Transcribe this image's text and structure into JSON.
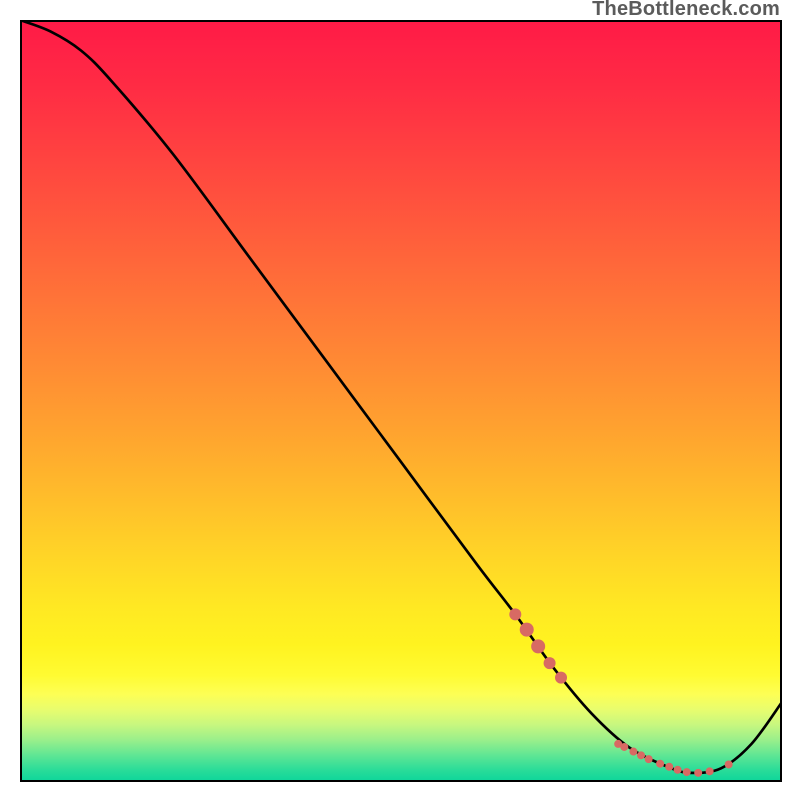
{
  "watermark": "TheBottleneck.com",
  "chart_data": {
    "type": "line",
    "title": "",
    "xlabel": "",
    "ylabel": "",
    "xlim": [
      0,
      100
    ],
    "ylim": [
      0,
      100
    ],
    "series": [
      {
        "name": "curve",
        "x": [
          0,
          4,
          8,
          12,
          20,
          30,
          40,
          50,
          60,
          65,
          70,
          75,
          80,
          85,
          88,
          92,
          96,
          100
        ],
        "y": [
          100,
          98.5,
          96,
          92,
          82.5,
          69,
          55.5,
          42,
          28.5,
          22,
          15,
          9,
          4.5,
          2,
          1.2,
          1.8,
          5,
          10.5
        ]
      }
    ],
    "markers": {
      "name": "highlighted-points",
      "color": "#d86a63",
      "points": [
        {
          "x": 65.0,
          "y": 22.0,
          "r": 6
        },
        {
          "x": 66.5,
          "y": 20.0,
          "r": 7
        },
        {
          "x": 68.0,
          "y": 17.8,
          "r": 7
        },
        {
          "x": 69.5,
          "y": 15.6,
          "r": 6
        },
        {
          "x": 71.0,
          "y": 13.7,
          "r": 6
        },
        {
          "x": 78.5,
          "y": 5.0,
          "r": 4
        },
        {
          "x": 79.3,
          "y": 4.6,
          "r": 4
        },
        {
          "x": 80.5,
          "y": 4.0,
          "r": 4
        },
        {
          "x": 81.5,
          "y": 3.5,
          "r": 4
        },
        {
          "x": 82.5,
          "y": 3.0,
          "r": 4
        },
        {
          "x": 84.0,
          "y": 2.4,
          "r": 4
        },
        {
          "x": 85.2,
          "y": 2.0,
          "r": 4
        },
        {
          "x": 86.3,
          "y": 1.6,
          "r": 4
        },
        {
          "x": 87.5,
          "y": 1.3,
          "r": 4
        },
        {
          "x": 89.0,
          "y": 1.2,
          "r": 4
        },
        {
          "x": 90.5,
          "y": 1.4,
          "r": 4
        },
        {
          "x": 93.0,
          "y": 2.3,
          "r": 4
        }
      ]
    },
    "gradient_stops": [
      {
        "offset": 0.0,
        "color": "#ff1a47"
      },
      {
        "offset": 0.09,
        "color": "#ff2c44"
      },
      {
        "offset": 0.18,
        "color": "#ff4340"
      },
      {
        "offset": 0.27,
        "color": "#ff5a3c"
      },
      {
        "offset": 0.36,
        "color": "#ff7238"
      },
      {
        "offset": 0.45,
        "color": "#ff8a34"
      },
      {
        "offset": 0.54,
        "color": "#ffa32f"
      },
      {
        "offset": 0.62,
        "color": "#ffbb2b"
      },
      {
        "offset": 0.7,
        "color": "#ffd427"
      },
      {
        "offset": 0.77,
        "color": "#ffe823"
      },
      {
        "offset": 0.82,
        "color": "#fff320"
      },
      {
        "offset": 0.86,
        "color": "#fffb32"
      },
      {
        "offset": 0.885,
        "color": "#fdff55"
      },
      {
        "offset": 0.905,
        "color": "#e8fd6e"
      },
      {
        "offset": 0.925,
        "color": "#c7f77f"
      },
      {
        "offset": 0.945,
        "color": "#99ef8b"
      },
      {
        "offset": 0.965,
        "color": "#5fe694"
      },
      {
        "offset": 0.985,
        "color": "#28dc99"
      },
      {
        "offset": 1.0,
        "color": "#0bd59a"
      }
    ]
  }
}
